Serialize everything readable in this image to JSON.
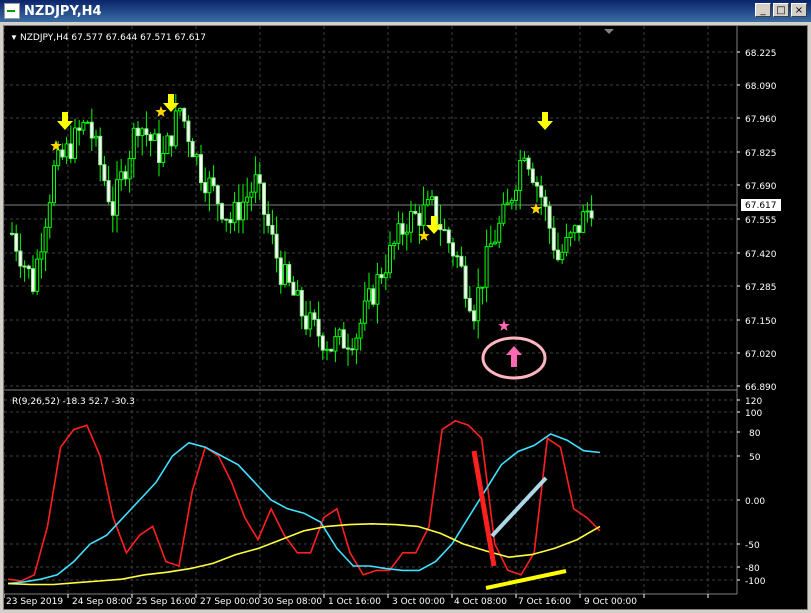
{
  "window": {
    "title": "NZDJPY,H4",
    "buttons": {
      "minimize": "_",
      "maximize": "□",
      "close": "×"
    }
  },
  "main_chart": {
    "header": "NZDJPY,H4  67.577 67.644 67.571 67.617",
    "price_labels": [
      "68.225",
      "68.090",
      "67.960",
      "67.825",
      "67.690",
      "67.555",
      "67.420",
      "67.285",
      "67.150",
      "67.020",
      "66.890"
    ],
    "current_price": "67.617",
    "colors": {
      "bull": "#90ee90",
      "bear": "#00ff00",
      "arrow_down": "#ffff00",
      "star": "#ffd700",
      "arrow_up": "#ff69b4",
      "circle": "#ffb6c1"
    }
  },
  "indicator": {
    "header": "R(9,26,52) -18.3 52.7 -30.3",
    "levels": [
      "120",
      "100",
      "80",
      "50",
      "0.00",
      "-50",
      "-80",
      "-100"
    ]
  },
  "time_axis": [
    "23 Sep 2019",
    "24 Sep 08:00",
    "25 Sep 16:00",
    "27 Sep 00:00",
    "30 Sep 08:00",
    "1 Oct 16:00",
    "3 Oct 00:00",
    "4 Oct 08:00",
    "7 Oct 16:00",
    "9 Oct 00:00"
  ],
  "chart_data": [
    {
      "type": "candlestick",
      "symbol": "NZDJPY",
      "timeframe": "H4",
      "ylim": [
        66.89,
        68.25
      ],
      "last_price": 67.617
    },
    {
      "type": "line",
      "title": "R(9,26,52)",
      "ylim": [
        -100,
        120
      ],
      "series": [
        {
          "name": "R9",
          "values": [
            -90,
            -92,
            -85,
            -30,
            60,
            80,
            85,
            50,
            -20,
            -60,
            -40,
            -30,
            -70,
            -75,
            10,
            60,
            50,
            20,
            -20,
            -45,
            -10,
            -40,
            -60,
            -60,
            -20,
            -10,
            -60,
            -85,
            -80,
            -80,
            -60,
            -60,
            -30,
            80,
            90,
            85,
            70,
            -50,
            -80,
            -85,
            -60,
            70,
            60,
            -10,
            -20,
            -35
          ]
        },
        {
          "name": "R26",
          "values": [
            -95,
            -93,
            -90,
            -85,
            -70,
            -50,
            -40,
            -20,
            0,
            20,
            50,
            65,
            60,
            50,
            40,
            20,
            0,
            -10,
            -15,
            -25,
            -55,
            -75,
            -75,
            -78,
            -80,
            -80,
            -70,
            -50,
            -20,
            10,
            40,
            55,
            62,
            75,
            68,
            56,
            54
          ]
        },
        {
          "name": "R52",
          "values": [
            -95,
            -96,
            -96,
            -94,
            -92,
            -90,
            -85,
            -82,
            -78,
            -72,
            -62,
            -55,
            -45,
            -35,
            -30,
            -28,
            -27,
            -28,
            -30,
            -38,
            -50,
            -58,
            -65,
            -62,
            -55,
            -45,
            -30
          ]
        }
      ]
    }
  ]
}
